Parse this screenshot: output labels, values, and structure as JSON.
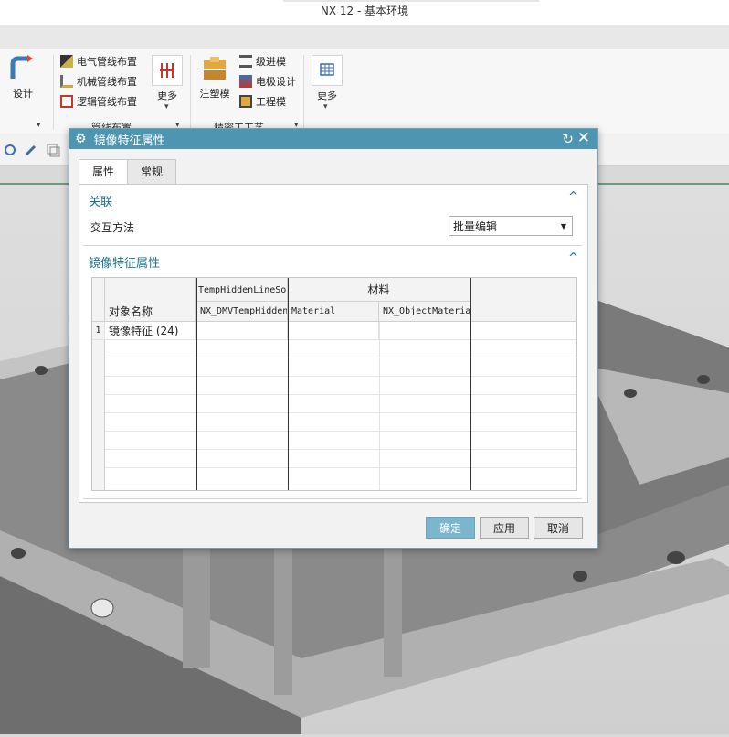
{
  "window": {
    "title": "NX 12 - 基本环境"
  },
  "ribbon": {
    "design_label": "设计",
    "routing": {
      "items": [
        "电气管线布置",
        "机械管线布置",
        "逻辑管线布置"
      ],
      "more_label": "更多",
      "group_label": "管线布置"
    },
    "molds": {
      "big_label": "注塑模",
      "items": [
        "级进模",
        "电极设计",
        "工程模"
      ],
      "group_label": "精密工工艺"
    },
    "more_label": "更多"
  },
  "dialog": {
    "title": "镜像特征属性",
    "tabs": [
      {
        "label": "属性",
        "active": true
      },
      {
        "label": "常规",
        "active": false
      }
    ],
    "section1": {
      "title": "关联",
      "field_label": "交互方法",
      "select_value": "批量编辑"
    },
    "section2": {
      "title": "镜像特征属性"
    },
    "grid": {
      "group_headers": [
        "TempHiddenLineSo",
        "材料"
      ],
      "columns": [
        "对象名称",
        "NX_DMVTempHiddenLineSo",
        "Material",
        "NX_ObjectMaterial"
      ],
      "rows": [
        {
          "num": "1",
          "name": "镜像特征 (24)"
        }
      ]
    },
    "buttons": {
      "ok": "确定",
      "apply": "应用",
      "cancel": "取消"
    }
  },
  "colors": {
    "title_bar": "#4e95b2",
    "accent_text": "#1c6f8d",
    "ok_button": "#7cb6cd"
  }
}
